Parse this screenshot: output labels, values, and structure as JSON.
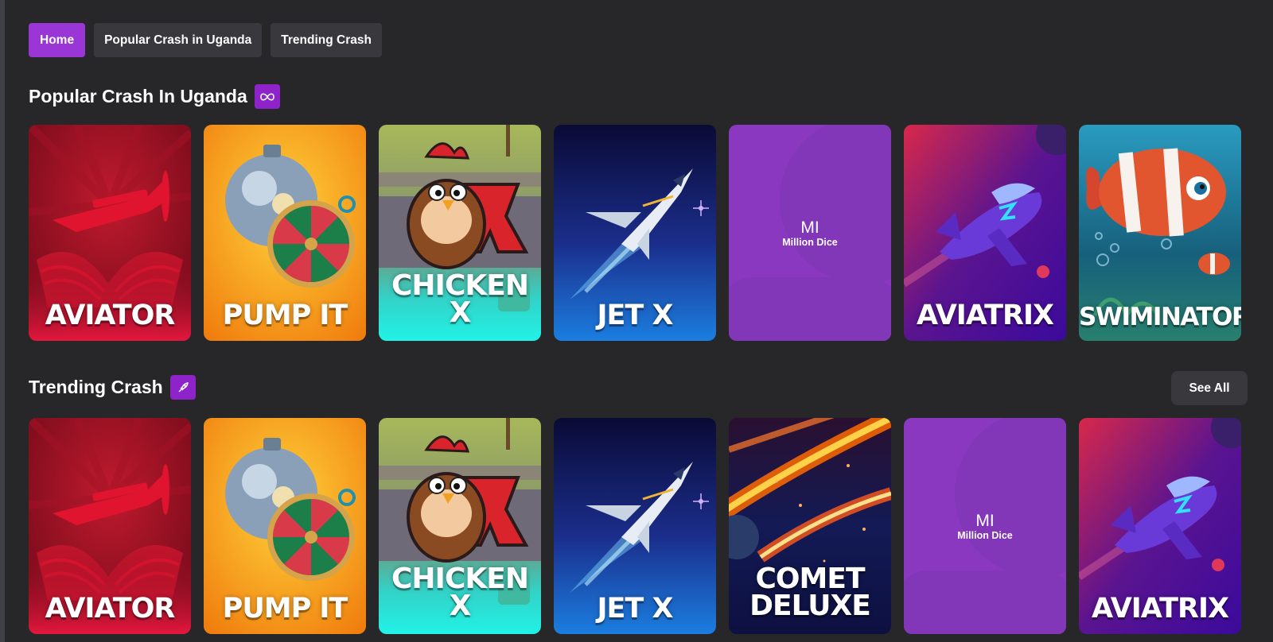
{
  "nav": {
    "items": [
      {
        "label": "Home",
        "active": true
      },
      {
        "label": "Popular Crash in Uganda",
        "active": false
      },
      {
        "label": "Trending Crash",
        "active": false
      }
    ]
  },
  "sections": {
    "popular": {
      "title": "Popular Crash In Uganda",
      "icon": "infinity-icon",
      "games": [
        {
          "label": "AVIATOR",
          "icon": "airplane-icon"
        },
        {
          "label": "PUMP IT",
          "icon": "wheel-icon"
        },
        {
          "label_line1": "CHICKEN",
          "label_line2": "X",
          "icon": "chicken-icon"
        },
        {
          "label": "JET X",
          "icon": "jet-icon"
        },
        {
          "abbr": "MI",
          "name": "Million Dice"
        },
        {
          "label": "AVIATRIX",
          "icon": "rocket-plane-icon"
        },
        {
          "label": "SWIMINATOR",
          "icon": "fish-icon"
        }
      ]
    },
    "trending": {
      "title": "Trending Crash",
      "icon": "rocket-icon",
      "see_all": "See All",
      "games": [
        {
          "label": "AVIATOR",
          "icon": "airplane-icon"
        },
        {
          "label": "PUMP IT",
          "icon": "wheel-icon"
        },
        {
          "label_line1": "CHICKEN",
          "label_line2": "X",
          "icon": "chicken-icon"
        },
        {
          "label": "JET X",
          "icon": "jet-icon"
        },
        {
          "label_line1": "COMET",
          "label_line2": "DELUXE",
          "icon": "comet-icon"
        },
        {
          "abbr": "MI",
          "name": "Million Dice"
        },
        {
          "label": "AVIATRIX",
          "icon": "rocket-plane-icon"
        }
      ]
    }
  },
  "colors": {
    "background": "#27272a",
    "accent": "#9b36d6",
    "pill": "#38383d",
    "placeholder": "#8a38c0"
  }
}
